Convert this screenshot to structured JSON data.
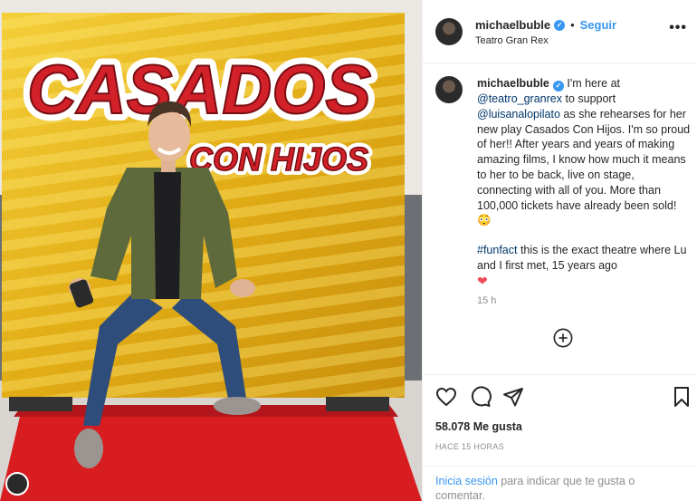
{
  "photo": {
    "sign_line1": "CASADOS",
    "sign_line2": "CON HIJOS"
  },
  "header": {
    "username": "michaelbuble",
    "follow_label": "Seguir",
    "location": "Teatro Gran Rex",
    "more_label": "•••"
  },
  "caption": {
    "username": "michaelbuble",
    "text1": " I'm here at ",
    "mention1": "@teatro_granrex",
    "text2": " to support ",
    "mention2": "@luisanalopilato",
    "text3": " as she rehearses for her new play Casados Con Hijos. I'm so proud of her!! After years and years of making amazing films, I know how much it means to her to be back, live on stage, connecting with all of you. More than 100,000 tickets have already been sold! 😳",
    "hashtag": "#funfact",
    "text4": " this is the exact theatre where Lu and I first met, 15 years ago",
    "heart": "❤",
    "time": "15 h"
  },
  "footer": {
    "likes": "58.078 Me gusta",
    "ago": "HACE 15 HORAS",
    "login_link": "Inicia sesión",
    "login_text": " para indicar que te gusta o comentar."
  },
  "icons": [
    "heart-icon",
    "comment-icon",
    "share-icon",
    "bookmark-icon",
    "add-comment-icon",
    "verified-icon",
    "more-icon"
  ],
  "colors": {
    "link": "#3897f0",
    "mention": "#00376b",
    "muted": "#8e8e8e",
    "heart": "#ed4956",
    "carpet": "#d81d20",
    "board": "#e8b51a"
  }
}
